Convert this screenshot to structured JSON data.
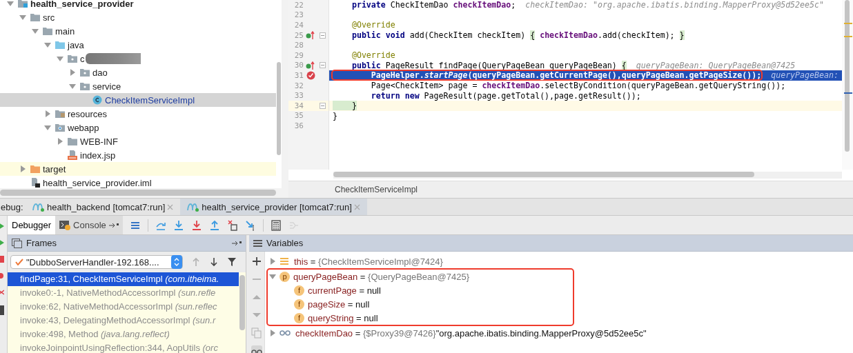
{
  "project_tree": {
    "items": [
      {
        "label": "health_service_provider",
        "kind": "module",
        "expanded": true,
        "selected": false,
        "children": [
          {
            "label": "src",
            "kind": "folder",
            "expanded": true,
            "selected": false,
            "children": [
              {
                "label": "main",
                "kind": "folder",
                "expanded": true,
                "selected": false,
                "children": [
                  {
                    "label": "java",
                    "kind": "source-root",
                    "expanded": true,
                    "selected": false,
                    "children": [
                      {
                        "label": "c",
                        "kind": "redacted-package",
                        "expanded": true,
                        "selected": false,
                        "children": [
                          {
                            "label": "dao",
                            "kind": "package",
                            "expanded": false,
                            "selected": false
                          },
                          {
                            "label": "service",
                            "kind": "package",
                            "expanded": true,
                            "selected": false,
                            "children": [
                              {
                                "label": "CheckItemServiceImpl",
                                "kind": "class",
                                "selected": true
                              }
                            ]
                          }
                        ]
                      }
                    ]
                  },
                  {
                    "label": "resources",
                    "kind": "resources",
                    "expanded": false,
                    "selected": false
                  },
                  {
                    "label": "webapp",
                    "kind": "web",
                    "expanded": true,
                    "selected": false,
                    "children": [
                      {
                        "label": "WEB-INF",
                        "kind": "folder",
                        "expanded": false,
                        "selected": false
                      },
                      {
                        "label": "index.jsp",
                        "kind": "jsp",
                        "selected": false
                      }
                    ]
                  }
                ]
              }
            ]
          },
          {
            "label": "target",
            "kind": "excluded",
            "expanded": false,
            "selected": false
          },
          {
            "label": "health_service_provider.iml",
            "kind": "iml",
            "selected": false
          }
        ]
      }
    ]
  },
  "editor": {
    "lines": [
      {
        "number": "22",
        "kind": "plain",
        "fold": false,
        "current": false,
        "caret": false,
        "annotated": false,
        "tokens": [
          {
            "kind": "kw",
            "text": "    private"
          },
          {
            "kind": "plain",
            "text": " CheckItemDao "
          },
          {
            "kind": "field",
            "text": "checkItemDao"
          },
          {
            "kind": "plain",
            "text": ";"
          }
        ],
        "hint": "checkItemDao: \"org.apache.ibatis.binding.MapperProxy@5d52ee5c\""
      },
      {
        "number": "23",
        "kind": "plain",
        "fold": false,
        "current": false,
        "caret": false,
        "annotated": false
      },
      {
        "number": "24",
        "kind": "plain",
        "fold": false,
        "current": false,
        "caret": false,
        "annotated": false,
        "tokens": [
          {
            "kind": "annotation",
            "text": "    @Override"
          }
        ]
      },
      {
        "number": "25",
        "kind": "override",
        "fold": true,
        "current": false,
        "caret": false,
        "annotated": false,
        "tokens": [
          {
            "kind": "kw",
            "text": "    public void"
          },
          {
            "kind": "plain",
            "text": " add(CheckItem checkItem) "
          },
          {
            "kind": "brace",
            "text": "{"
          },
          {
            "kind": "field",
            "text": " checkItemDao"
          },
          {
            "kind": "plain",
            "text": ".add(checkItem); "
          },
          {
            "kind": "brace",
            "text": "}"
          }
        ]
      },
      {
        "number": "28",
        "kind": "plain",
        "fold": false,
        "current": false,
        "caret": false,
        "annotated": false
      },
      {
        "number": "29",
        "kind": "plain",
        "fold": false,
        "current": false,
        "caret": false,
        "annotated": false,
        "tokens": [
          {
            "kind": "annotation",
            "text": "    @Override"
          }
        ]
      },
      {
        "number": "30",
        "kind": "override",
        "fold": true,
        "current": false,
        "caret": false,
        "annotated": false,
        "tokens": [
          {
            "kind": "kw",
            "text": "    public"
          },
          {
            "kind": "plain",
            "text": " PageResult findPage(QueryPageBean queryPageBean) "
          },
          {
            "kind": "brace",
            "text": "{"
          }
        ],
        "hint": "queryPageBean: QueryPageBean@7425"
      },
      {
        "number": "31",
        "kind": "breakpoint",
        "fold": false,
        "current": true,
        "caret": false,
        "annotated": true,
        "tokens": [
          {
            "kind": "plain",
            "text": "        PageHelper."
          },
          {
            "kind": "static",
            "text": "startPage"
          },
          {
            "kind": "plain",
            "text": "(queryPageBean.getCurrentPage(),queryPageBean.getPageSize());"
          }
        ],
        "hint": "queryPageBean:"
      },
      {
        "number": "32",
        "kind": "plain",
        "fold": false,
        "current": false,
        "caret": false,
        "annotated": false,
        "tokens": [
          {
            "kind": "plain",
            "text": "        Page<CheckItem> page = "
          },
          {
            "kind": "field",
            "text": "checkItemDao"
          },
          {
            "kind": "plain",
            "text": ".selectByCondition(queryPageBean.getQueryString());"
          }
        ]
      },
      {
        "number": "33",
        "kind": "plain",
        "fold": false,
        "current": false,
        "caret": false,
        "annotated": false,
        "tokens": [
          {
            "kind": "kw",
            "text": "        return new"
          },
          {
            "kind": "plain",
            "text": " PageResult(page.getTotal(),page.getResult());"
          }
        ]
      },
      {
        "number": "34",
        "kind": "plain",
        "fold": true,
        "current": false,
        "caret": true,
        "annotated": false,
        "tokens": [
          {
            "kind": "brace",
            "text": "    }"
          }
        ]
      },
      {
        "number": "35",
        "kind": "plain",
        "fold": false,
        "current": false,
        "caret": false,
        "annotated": false,
        "tokens": [
          {
            "kind": "plain",
            "text": "}"
          }
        ]
      },
      {
        "number": "36",
        "kind": "plain",
        "fold": false,
        "current": false,
        "caret": false,
        "annotated": false
      }
    ],
    "breadcrumb": "CheckItemServiceImpl"
  },
  "debug": {
    "label": "ebug:",
    "tabs": [
      {
        "label": "health_backend [tomcat7:run]",
        "selected": false
      },
      {
        "label": "health_service_provider [tomcat7:run]",
        "selected": true
      }
    ]
  },
  "toolbar": {
    "tabs": [
      {
        "label": "Debugger",
        "selected": true
      },
      {
        "label": "Console",
        "selected": false
      }
    ],
    "actions": [
      {
        "kind": "layout",
        "disabled": false
      },
      {
        "kind": "step-over",
        "disabled": false
      },
      {
        "kind": "step-into",
        "disabled": false
      },
      {
        "kind": "force-step-into",
        "disabled": false
      },
      {
        "kind": "step-out",
        "disabled": false
      },
      {
        "kind": "drop-frame",
        "disabled": false
      },
      {
        "kind": "run-to-cursor",
        "disabled": false
      },
      {
        "kind": "evaluate",
        "disabled": false
      },
      {
        "kind": "trace",
        "disabled": true
      }
    ]
  },
  "frames": {
    "title": "Frames",
    "thread": "\"DubboServerHandler-192.168....",
    "nav": [
      {
        "kind": "up",
        "disabled": true
      },
      {
        "kind": "down",
        "disabled": false
      },
      {
        "kind": "filter",
        "disabled": false
      }
    ],
    "rows": [
      {
        "text": "findPage:31, CheckItemServiceImpl *(com.itheima.*",
        "selected": true,
        "library": false
      },
      {
        "text": "invoke0:-1, NativeMethodAccessorImpl *(sun.refle*",
        "selected": false,
        "library": true
      },
      {
        "text": "invoke:62, NativeMethodAccessorImpl *(sun.reflec*",
        "selected": false,
        "library": true
      },
      {
        "text": "invoke:43, DelegatingMethodAccessorImpl *(sun.r*",
        "selected": false,
        "library": true
      },
      {
        "text": "invoke:498, Method *(java.lang.reflect)*",
        "selected": false,
        "library": true
      },
      {
        "text": "invokeJoinpointUsingReflection:344, AopUtils *(orc*",
        "selected": false,
        "library": true
      }
    ]
  },
  "variables": {
    "title": "Variables",
    "tools": [
      {
        "kind": "add",
        "disabled": false
      },
      {
        "kind": "remove",
        "disabled": true
      },
      {
        "kind": "up",
        "disabled": true
      },
      {
        "kind": "down",
        "disabled": true
      },
      {
        "kind": "copy",
        "disabled": true
      },
      {
        "kind": "watches",
        "disabled": false
      }
    ],
    "items": [
      {
        "name": "this",
        "separator": "=",
        "kind": "object",
        "value": "{CheckItemServiceImpl@7424}",
        "expanded": false,
        "annotated": false
      },
      {
        "name": "queryPageBean",
        "separator": "=",
        "kind": "param",
        "badge": "p",
        "value": "{QueryPageBean@7425}",
        "expanded": true,
        "annotated": true,
        "children": [
          {
            "name": "currentPage",
            "separator": "=",
            "kind": "field",
            "badge": "f",
            "value": "null"
          },
          {
            "name": "pageSize",
            "separator": "=",
            "kind": "field",
            "badge": "f",
            "value": "null"
          },
          {
            "name": "queryString",
            "separator": "=",
            "kind": "field",
            "badge": "f",
            "value": "null"
          }
        ]
      },
      {
        "name": "checkItemDao",
        "separator": "=",
        "kind": "watch",
        "value": "{$Proxy39@7426}",
        "string": "\"org.apache.ibatis.binding.MapperProxy@5d52ee5c\"",
        "expanded": false,
        "annotated": false
      }
    ]
  }
}
